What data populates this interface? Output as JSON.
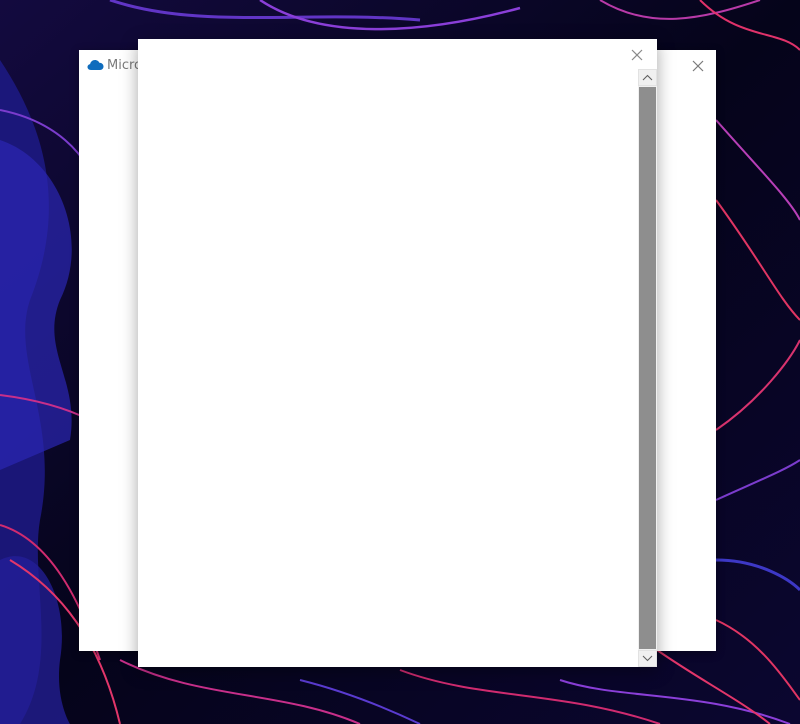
{
  "desktop": {
    "wallpaper": "dark-purple-blue-flowing-lines"
  },
  "back_window": {
    "title": "Microsoft OneDrive",
    "app_icon": "onedrive-cloud-icon",
    "close_icon": "close-icon"
  },
  "front_window": {
    "close_icon": "close-icon",
    "scrollbar": {
      "up_icon": "chevron-up-icon",
      "down_icon": "chevron-down-icon"
    }
  },
  "colors": {
    "onedrive_blue": "#0f6cbd",
    "scroll_thumb": "#8e8e8e",
    "wallpaper_base": "#07051c",
    "wallpaper_accent": "#c9206a"
  }
}
